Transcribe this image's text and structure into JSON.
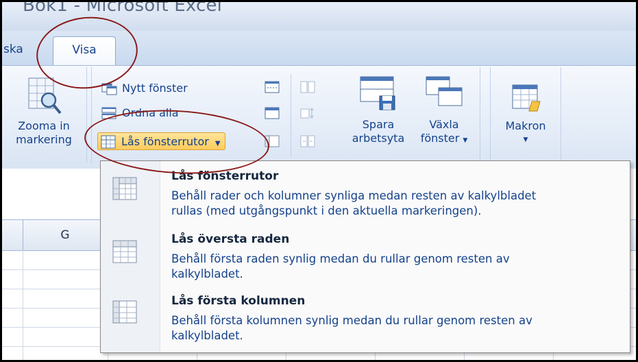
{
  "window": {
    "title": "Bok1 - Microsoft Excel"
  },
  "tabs": {
    "prev_label": "ska",
    "active_label": "Visa"
  },
  "ribbon": {
    "zoom_selection": {
      "line1": "Zooma in",
      "line2": "markering"
    },
    "new_window": "Nytt fönster",
    "arrange_all": "Ordna alla",
    "freeze_panes": "Lås fönsterrutor",
    "save_workspace": {
      "line1": "Spara",
      "line2": "arbetsyta"
    },
    "switch_windows": {
      "line1": "Växla",
      "line2": "fönster"
    },
    "macros": {
      "line1": "Makron"
    }
  },
  "grid": {
    "column_g": "G"
  },
  "menu": {
    "items": [
      {
        "title": "Lås fönsterrutor",
        "desc_line1": "Behåll rader och kolumner synliga medan resten av kalkylbladet",
        "desc_line2": "rullas (med utgångspunkt i den aktuella markeringen)."
      },
      {
        "title": "Lås översta raden",
        "desc_line1": "Behåll första raden synlig medan du rullar genom resten av",
        "desc_line2": "kalkylbladet."
      },
      {
        "title": "Lås första kolumnen",
        "desc_line1": "Behåll första kolumnen synlig medan du rullar genom resten av",
        "desc_line2": "kalkylbladet."
      }
    ]
  },
  "colors": {
    "accent": "#ffcb5c",
    "text": "#15428b",
    "annotation": "#8b1a1a"
  }
}
